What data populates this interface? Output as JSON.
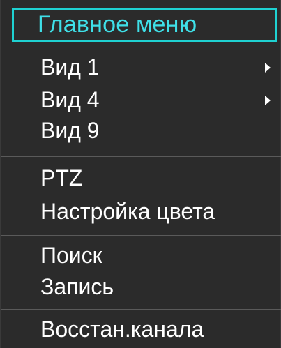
{
  "menu": {
    "title": "Главное меню",
    "groups": [
      [
        {
          "label": "Вид 1",
          "submenu": true
        },
        {
          "label": "Вид 4",
          "submenu": true
        },
        {
          "label": "Вид 9",
          "submenu": false
        }
      ],
      [
        {
          "label": "PTZ",
          "submenu": false
        },
        {
          "label": "Настройка цвета",
          "submenu": false
        }
      ],
      [
        {
          "label": "Поиск",
          "submenu": false
        },
        {
          "label": "Запись",
          "submenu": false
        }
      ],
      [
        {
          "label": "Восстан.канала",
          "submenu": false
        }
      ]
    ]
  },
  "colors": {
    "background": "#2b2b2b",
    "accent": "#1fd1d1",
    "text": "#ffffff",
    "divider": "#5a5a5a"
  },
  "icons": {
    "submenu_arrow": "chevron-right-icon"
  }
}
